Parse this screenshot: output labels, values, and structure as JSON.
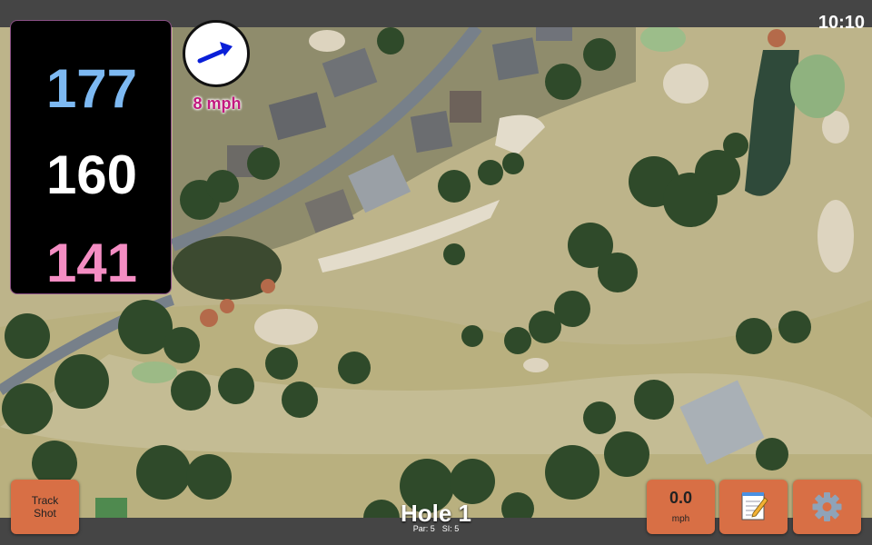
{
  "status": {
    "time": "10:10"
  },
  "distances": {
    "back": "177",
    "middle": "160",
    "front": "141"
  },
  "wind": {
    "speed_label": "8 mph",
    "direction": "east-northeast"
  },
  "buttons": {
    "track_shot_line1": "Track",
    "track_shot_line2": "Shot",
    "wind_speed_value": "0.0",
    "wind_speed_unit": "mph",
    "notes_icon": "notepad-icon",
    "settings_icon": "gear-icon"
  },
  "hole": {
    "title": "Hole 1",
    "par": "Par: 5",
    "si": "SI: 5"
  },
  "colors": {
    "back_distance": "#7db9f2",
    "middle_distance": "#ffffff",
    "front_distance": "#f48dc3",
    "button": "#d86f45",
    "wind_label": "#c2187f"
  }
}
